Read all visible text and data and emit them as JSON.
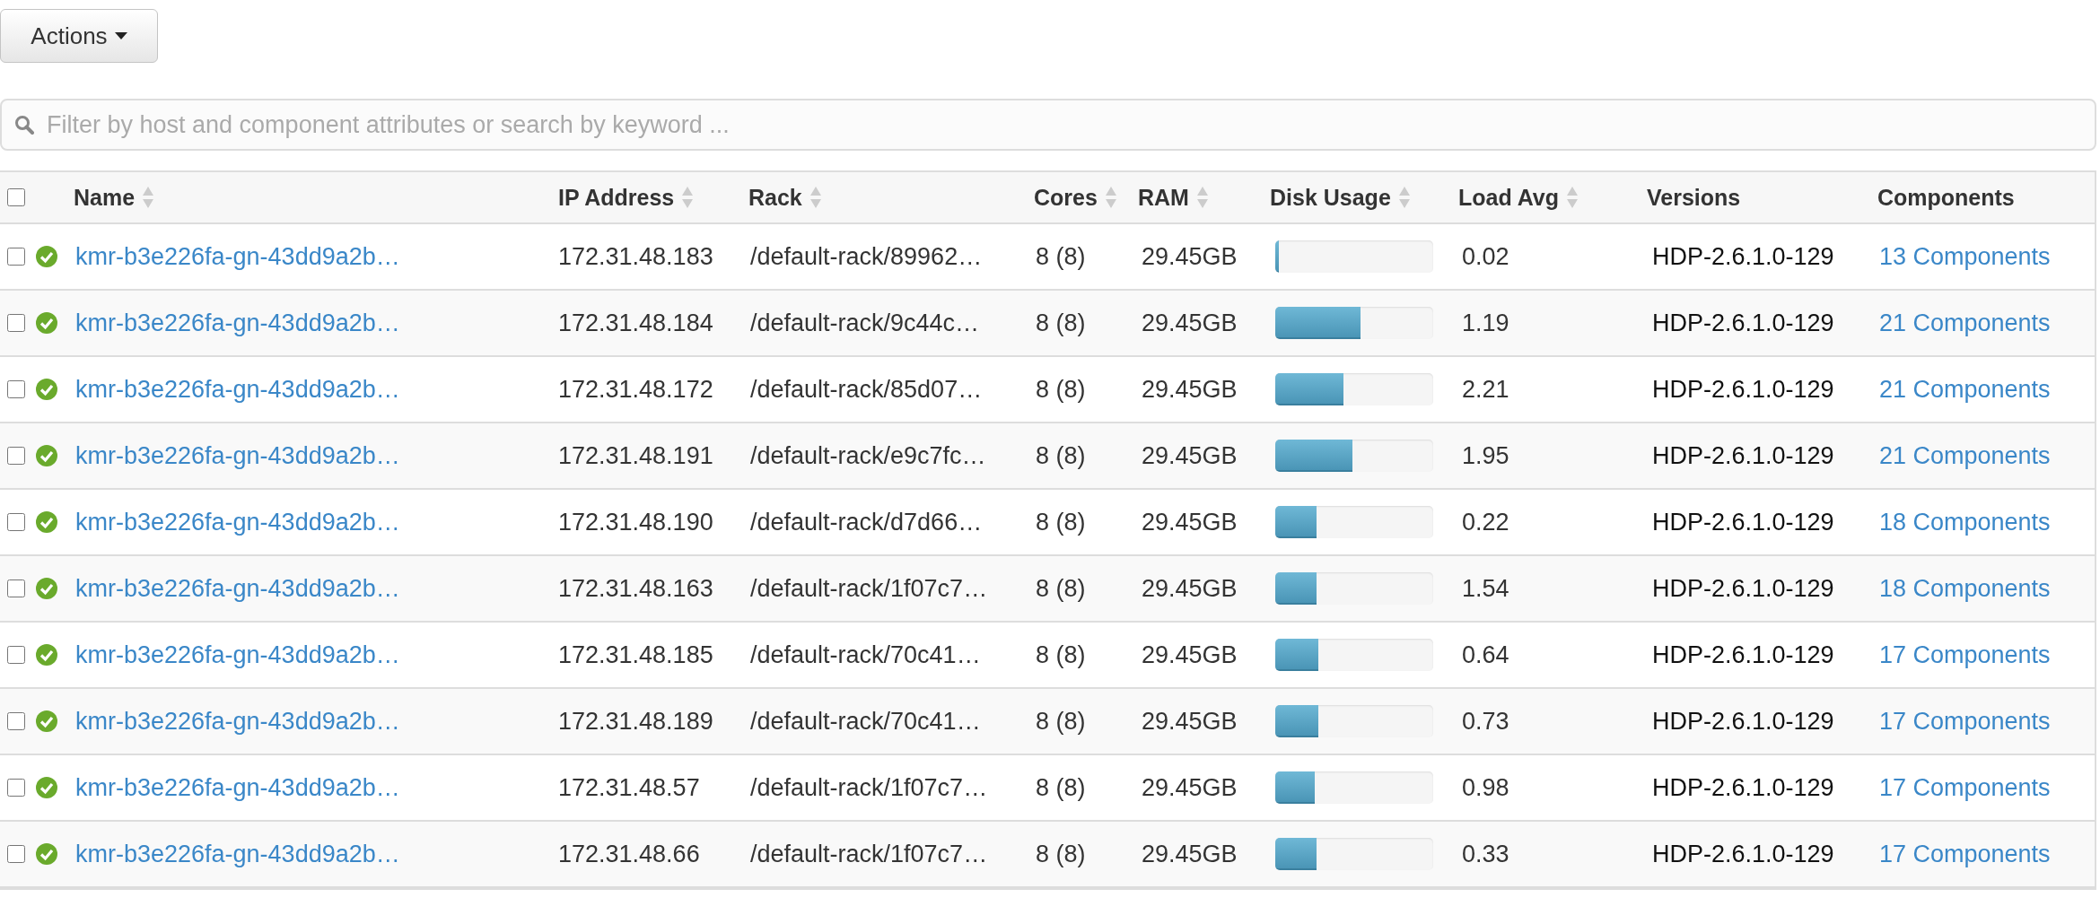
{
  "actions_button": {
    "label": "Actions"
  },
  "search": {
    "placeholder": "Filter by host and component attributes or search by keyword ..."
  },
  "table": {
    "select_all": {
      "checked": false
    },
    "columns": [
      {
        "label": "Name",
        "sortable": true
      },
      {
        "label": "IP Address",
        "sortable": true
      },
      {
        "label": "Rack",
        "sortable": true
      },
      {
        "label": "Cores",
        "sortable": true
      },
      {
        "label": "RAM",
        "sortable": true
      },
      {
        "label": "Disk Usage",
        "sortable": true
      },
      {
        "label": "Load Avg",
        "sortable": true
      },
      {
        "label": "Versions",
        "sortable": false
      },
      {
        "label": "Components",
        "sortable": false
      }
    ],
    "rows": [
      {
        "checked": false,
        "name": "kmr-b3e226fa-gn-43dd9a2b…",
        "ip": "172.31.48.183",
        "rack": "/default-rack/89962…",
        "cores": "8 (8)",
        "ram": "29.45GB",
        "disk": {
          "level": 0.02
        },
        "load": "0.02",
        "version": "HDP-2.6.1.0-129",
        "components": "13 Components"
      },
      {
        "checked": false,
        "name": "kmr-b3e226fa-gn-43dd9a2b…",
        "ip": "172.31.48.184",
        "rack": "/default-rack/9c44c…",
        "cores": "8 (8)",
        "ram": "29.45GB",
        "disk": {
          "level": 0.54
        },
        "load": "1.19",
        "version": "HDP-2.6.1.0-129",
        "components": "21 Components"
      },
      {
        "checked": false,
        "name": "kmr-b3e226fa-gn-43dd9a2b…",
        "ip": "172.31.48.172",
        "rack": "/default-rack/85d07…",
        "cores": "8 (8)",
        "ram": "29.45GB",
        "disk": {
          "level": 0.43
        },
        "load": "2.21",
        "version": "HDP-2.6.1.0-129",
        "components": "21 Components"
      },
      {
        "checked": false,
        "name": "kmr-b3e226fa-gn-43dd9a2b…",
        "ip": "172.31.48.191",
        "rack": "/default-rack/e9c7fc…",
        "cores": "8 (8)",
        "ram": "29.45GB",
        "disk": {
          "level": 0.49
        },
        "load": "1.95",
        "version": "HDP-2.6.1.0-129",
        "components": "21 Components"
      },
      {
        "checked": false,
        "name": "kmr-b3e226fa-gn-43dd9a2b…",
        "ip": "172.31.48.190",
        "rack": "/default-rack/d7d66…",
        "cores": "8 (8)",
        "ram": "29.45GB",
        "disk": {
          "level": 0.26
        },
        "load": "0.22",
        "version": "HDP-2.6.1.0-129",
        "components": "18 Components"
      },
      {
        "checked": false,
        "name": "kmr-b3e226fa-gn-43dd9a2b…",
        "ip": "172.31.48.163",
        "rack": "/default-rack/1f07c7…",
        "cores": "8 (8)",
        "ram": "29.45GB",
        "disk": {
          "level": 0.26
        },
        "load": "1.54",
        "version": "HDP-2.6.1.0-129",
        "components": "18 Components"
      },
      {
        "checked": false,
        "name": "kmr-b3e226fa-gn-43dd9a2b…",
        "ip": "172.31.48.185",
        "rack": "/default-rack/70c41…",
        "cores": "8 (8)",
        "ram": "29.45GB",
        "disk": {
          "level": 0.27
        },
        "load": "0.64",
        "version": "HDP-2.6.1.0-129",
        "components": "17 Components"
      },
      {
        "checked": false,
        "name": "kmr-b3e226fa-gn-43dd9a2b…",
        "ip": "172.31.48.189",
        "rack": "/default-rack/70c41…",
        "cores": "8 (8)",
        "ram": "29.45GB",
        "disk": {
          "level": 0.27
        },
        "load": "0.73",
        "version": "HDP-2.6.1.0-129",
        "components": "17 Components"
      },
      {
        "checked": false,
        "name": "kmr-b3e226fa-gn-43dd9a2b…",
        "ip": "172.31.48.57",
        "rack": "/default-rack/1f07c7…",
        "cores": "8 (8)",
        "ram": "29.45GB",
        "disk": {
          "level": 0.25
        },
        "load": "0.98",
        "version": "HDP-2.6.1.0-129",
        "components": "17 Components"
      },
      {
        "checked": false,
        "name": "kmr-b3e226fa-gn-43dd9a2b…",
        "ip": "172.31.48.66",
        "rack": "/default-rack/1f07c7…",
        "cores": "8 (8)",
        "ram": "29.45GB",
        "disk": {
          "level": 0.26
        },
        "load": "0.33",
        "version": "HDP-2.6.1.0-129",
        "components": "17 Components"
      }
    ]
  }
}
